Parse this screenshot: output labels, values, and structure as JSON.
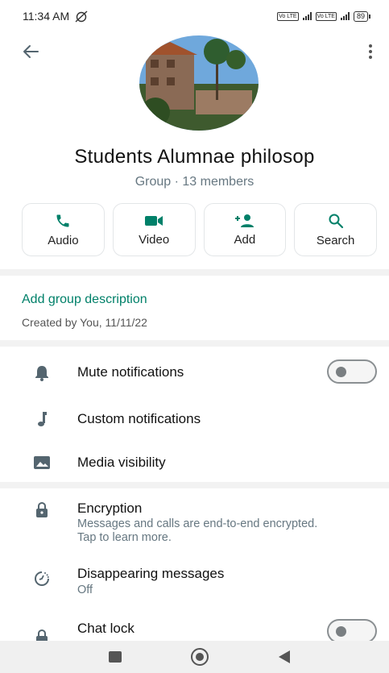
{
  "status_bar": {
    "time": "11:34 AM",
    "battery": "89",
    "sim_label": "Vo LTE"
  },
  "header": {
    "group_name": "Students Alumnae philosop",
    "group_meta": "Group · 13 members"
  },
  "actions": [
    {
      "label": "Audio",
      "icon": "phone-icon"
    },
    {
      "label": "Video",
      "icon": "video-camera-icon"
    },
    {
      "label": "Add",
      "icon": "add-person-icon"
    },
    {
      "label": "Search",
      "icon": "search-icon"
    }
  ],
  "description": {
    "add_label": "Add group description",
    "created": "Created by You, 11/11/22"
  },
  "settings": {
    "mute": {
      "title": "Mute notifications",
      "enabled": false
    },
    "custom": {
      "title": "Custom notifications"
    },
    "media": {
      "title": "Media visibility"
    },
    "encryption": {
      "title": "Encryption",
      "subtitle": "Messages and calls are end-to-end encrypted. Tap to learn more."
    },
    "disappearing": {
      "title": "Disappearing messages",
      "subtitle": "Off"
    },
    "chat_lock": {
      "title": "Chat lock",
      "enabled": false
    }
  },
  "colors": {
    "accent": "#008069",
    "muted": "#667781"
  }
}
